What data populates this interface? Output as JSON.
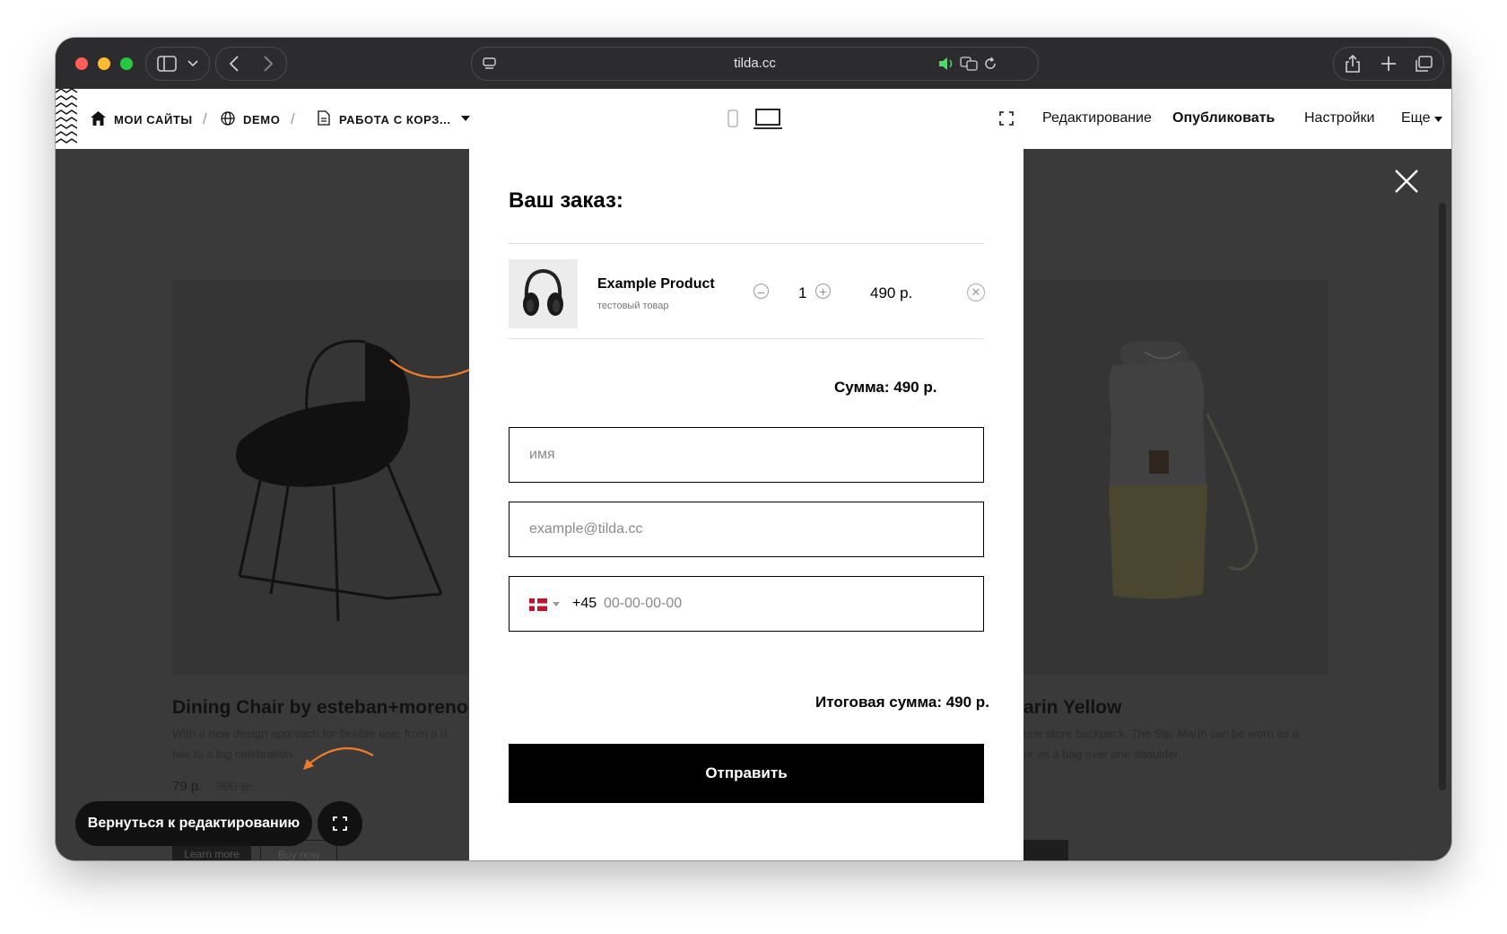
{
  "browser": {
    "url": "tilda.cc"
  },
  "tilda_bar": {
    "crumbs": [
      "МОИ САЙТЫ",
      "DEMO",
      "РАБОТА С КОРЗ..."
    ],
    "menu": {
      "edit": "Редактирование",
      "publish": "Опубликовать",
      "settings": "Настройки",
      "more": "Еще"
    }
  },
  "background": {
    "product_left": {
      "title": "Dining Chair by esteban+moreno",
      "description": "With a new design approach for flexible use; from a d",
      "description_line2": "two to a big celebration.",
      "price": "79 р.",
      "old_price": "300 р.",
      "learn_more": "Learn more",
      "buy_now": "Buy now"
    },
    "product_right": {
      "title": "arin Yellow",
      "description": "rine store backpack. The Sac Marin can be worn as a",
      "description_line2": "or as a bag over one shoulder."
    }
  },
  "cart": {
    "title": "Ваш заказ:",
    "item": {
      "name": "Example Product",
      "subtitle": "тестовый товар",
      "quantity": "1",
      "price": "490 р.",
      "thumbnail_icon": "headphones-icon"
    },
    "sum_label": "Сумма: 490 р.",
    "fields": {
      "name_placeholder": "имя",
      "email_placeholder": "example@tilda.cc",
      "phone_prefix": "+45",
      "phone_placeholder": "00-00-00-00",
      "country_flag": "denmark-flag-icon"
    },
    "total_label": "Итоговая сумма: 490 р.",
    "submit_label": "Отправить"
  },
  "overlay": {
    "back_to_edit": "Вернуться к редактированию"
  },
  "colors": {
    "accent_arrow": "#f07c2b",
    "overlay_bg": "#3a3a3a",
    "button_black": "#000000"
  }
}
